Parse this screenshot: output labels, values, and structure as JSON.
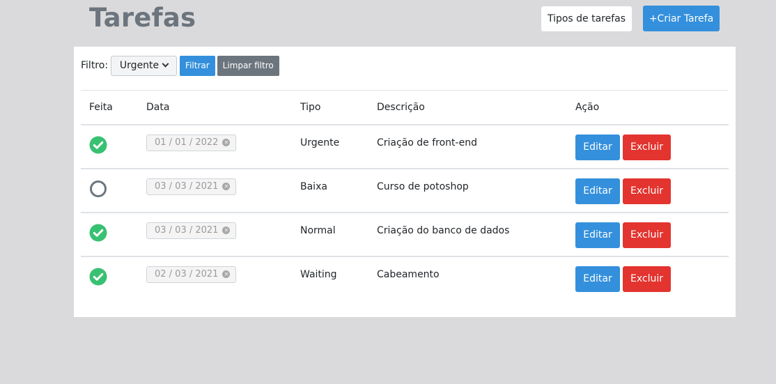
{
  "header": {
    "title": "Tarefas",
    "types_button": "Tipos de tarefas",
    "create_button": "+Criar Tarefa"
  },
  "filter": {
    "label": "Filtro:",
    "selected": "Urgente",
    "filter_button": "Filtrar",
    "clear_button": "Limpar filtro"
  },
  "table": {
    "headers": {
      "done": "Feita",
      "date": "Data",
      "type": "Tipo",
      "description": "Descrição",
      "action": "Ação"
    },
    "rows": [
      {
        "done": true,
        "date": "01 / 01 / 2022",
        "type": "Urgente",
        "description": "Criação de front-end",
        "edit": "Editar",
        "delete": "Excluir"
      },
      {
        "done": false,
        "date": "03 / 03 / 2021",
        "type": "Baixa",
        "description": "Curso de potoshop",
        "edit": "Editar",
        "delete": "Excluir"
      },
      {
        "done": true,
        "date": "03 / 03 / 2021",
        "type": "Normal",
        "description": "Criação do banco de dados",
        "edit": "Editar",
        "delete": "Excluir"
      },
      {
        "done": true,
        "date": "02 / 03 / 2021",
        "type": "Waiting",
        "description": "Cabeamento",
        "edit": "Editar",
        "delete": "Excluir"
      }
    ]
  },
  "colors": {
    "primary": "#3490dc",
    "danger": "#e3342f",
    "secondary": "#6c757d",
    "success": "#38c172",
    "background": "#dadadc"
  },
  "icons": {
    "done": "check-circle-icon",
    "not_done": "empty-circle-icon",
    "select": "chevron-down-icon",
    "clear": "clear-x-icon"
  }
}
